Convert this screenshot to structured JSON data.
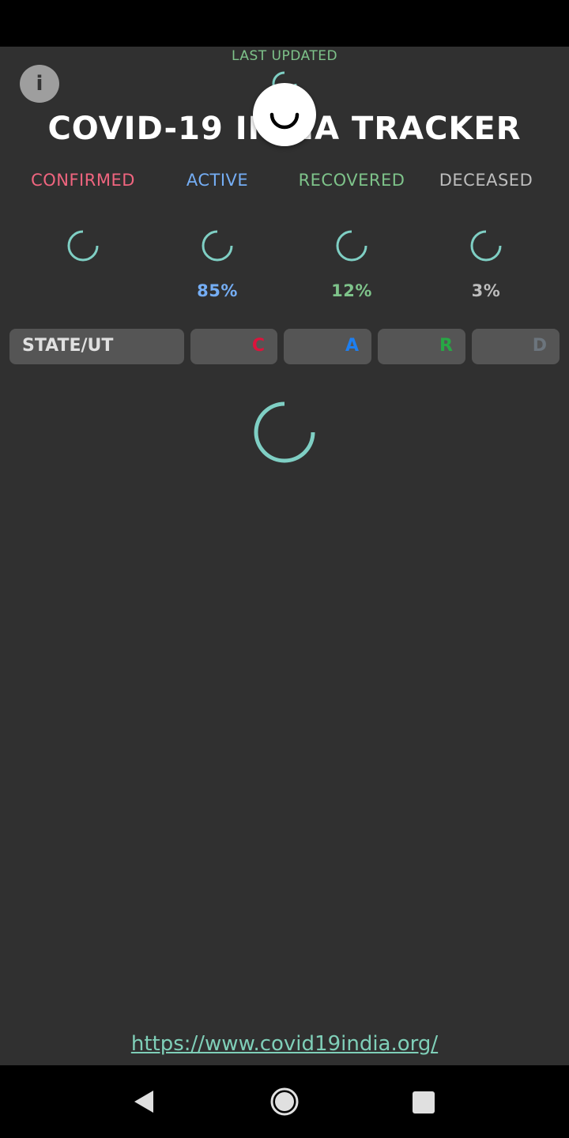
{
  "header": {
    "last_updated_label": "LAST UPDATED",
    "title": "COVID-19 INDIA TRACKER"
  },
  "stats": [
    {
      "label": "CONFIRMED",
      "percent": "",
      "color": "#f0657f"
    },
    {
      "label": "ACTIVE",
      "percent": "85%",
      "color": "#75aef5"
    },
    {
      "label": "RECOVERED",
      "percent": "12%",
      "color": "#7ec38a"
    },
    {
      "label": "DECEASED",
      "percent": "3%",
      "color": "#bdbdbd"
    }
  ],
  "table": {
    "state_label": "STATE/UT",
    "col_confirmed": "C",
    "col_active": "A",
    "col_recovered": "R",
    "col_deceased": "D"
  },
  "footer": {
    "link": "https://www.covid19india.org/"
  },
  "colors": {
    "background": "#303030",
    "spinner": "#7fcfc4",
    "confirmed": "#dc143c",
    "active": "#1e7ff0",
    "recovered": "#28a745",
    "deceased": "#6c757d"
  }
}
